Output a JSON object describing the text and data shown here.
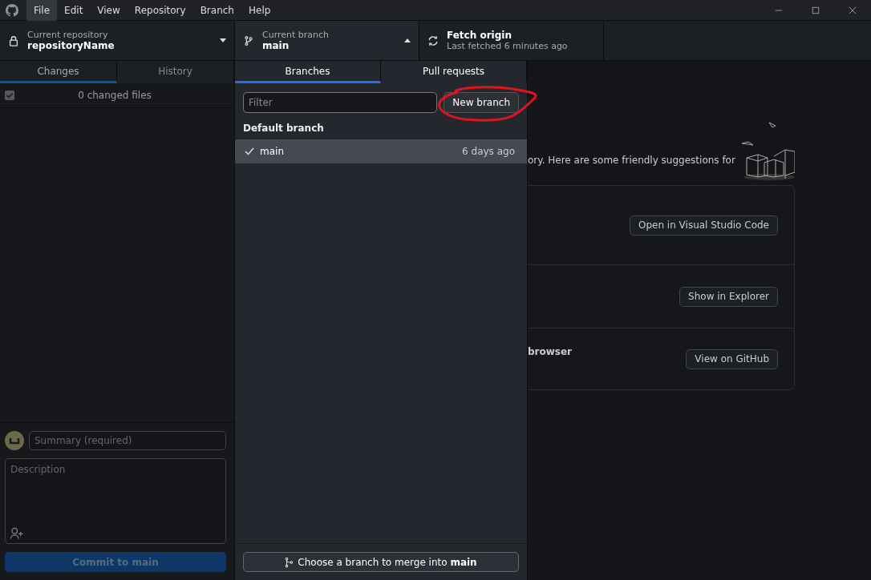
{
  "menu": [
    {
      "label": "File",
      "selected": true
    },
    {
      "label": "Edit",
      "selected": false
    },
    {
      "label": "View",
      "selected": false
    },
    {
      "label": "Repository",
      "selected": false
    },
    {
      "label": "Branch",
      "selected": false
    },
    {
      "label": "Help",
      "selected": false
    }
  ],
  "toolbar": {
    "repository": {
      "label": "Current repository",
      "value": "repositoryName",
      "expanded": false
    },
    "branch": {
      "label": "Current branch",
      "value": "main",
      "expanded": true
    },
    "fetch": {
      "label": "Fetch origin",
      "detail": "Last fetched 6 minutes ago"
    }
  },
  "sidebar": {
    "tabs": [
      {
        "label": "Changes",
        "selected": true
      },
      {
        "label": "History",
        "selected": false
      }
    ],
    "select_all_checked": true,
    "changes_summary": "0 changed files",
    "commit": {
      "summary_placeholder": "Summary (required)",
      "description_placeholder": "Description",
      "button": "Commit to main",
      "button_disabled": true
    }
  },
  "branch_menu": {
    "tabs": [
      {
        "label": "Branches",
        "selected": true
      },
      {
        "label": "Pull requests",
        "selected": false
      }
    ],
    "filter_placeholder": "Filter",
    "new_branch_button": "New branch",
    "groups": [
      {
        "heading": "Default branch",
        "branches": [
          {
            "name": "main",
            "time": "6 days ago",
            "selected": true
          }
        ]
      }
    ],
    "merge_button": "Choose a branch to merge into **main**"
  },
  "main": {
    "intro": "ory. Here are some friendly suggestions for",
    "suggestions": [
      {
        "button": "Open in Visual Studio Code"
      },
      {
        "button": "Show in Explorer"
      },
      {
        "text": "browser",
        "button": "View on GitHub"
      }
    ]
  },
  "annotations": [
    {
      "kind": "freehand-ellipse"
    }
  ]
}
